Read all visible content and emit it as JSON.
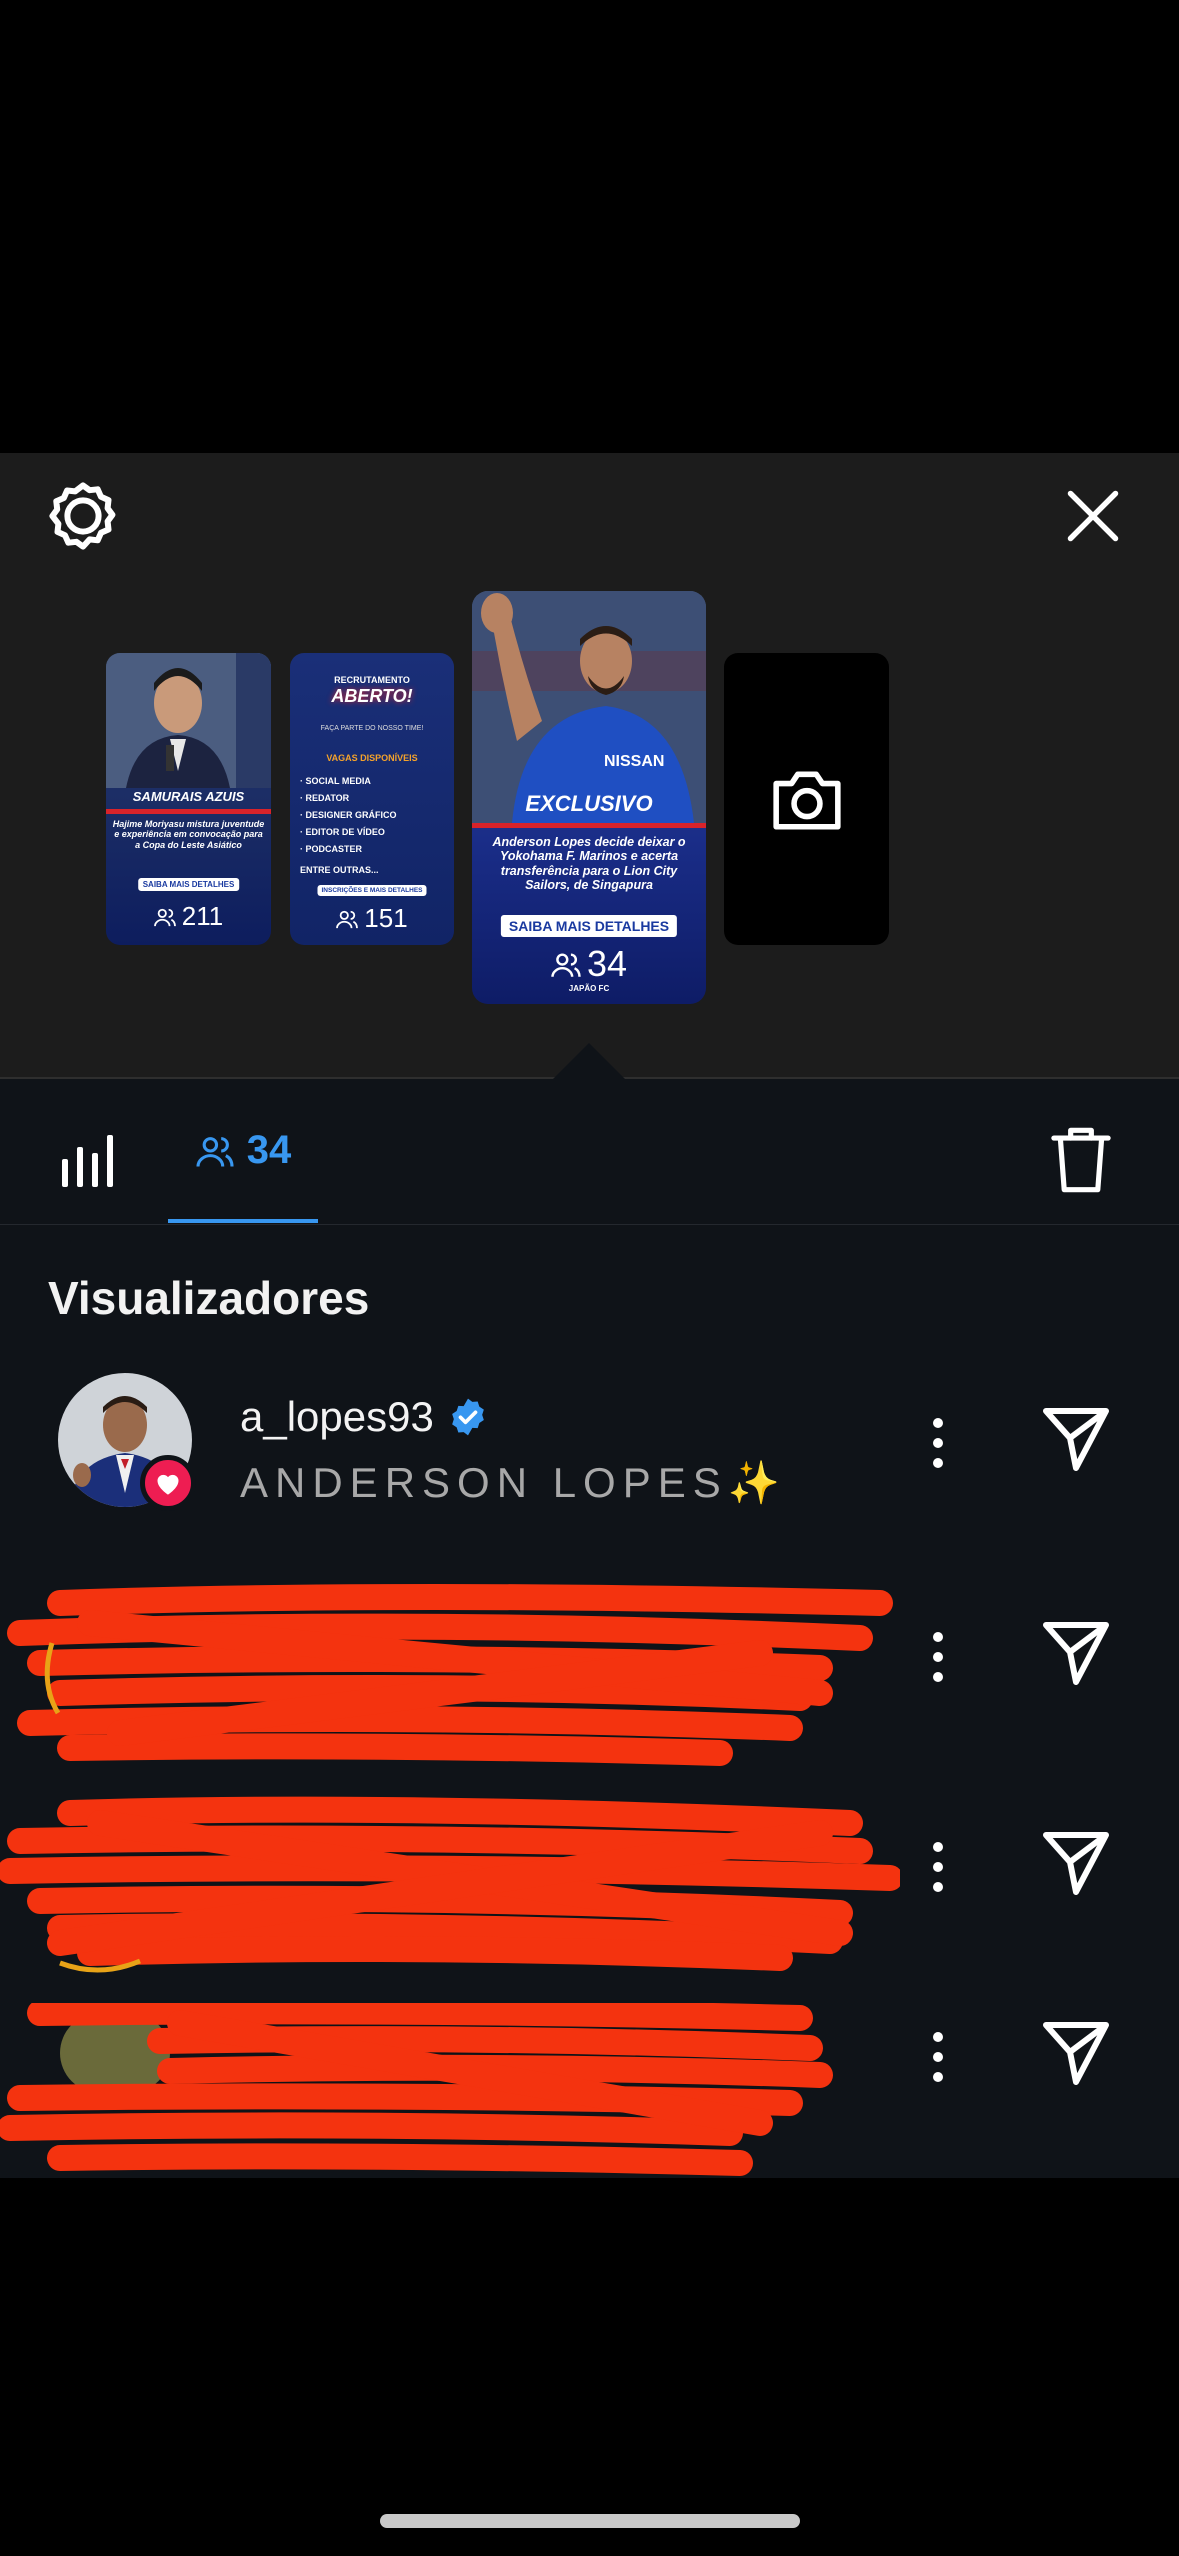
{
  "stories": [
    {
      "caption": "SAMURAIS AZUIS",
      "desc": "Hajime Moriyasu mistura juventude e experiência em convocação para a Copa do Leste Asiático",
      "button": "SAIBA MAIS DETALHES",
      "count": "211"
    },
    {
      "title_top": "RECRUTAMENTO",
      "title_main": "ABERTO!",
      "subtitle": "FAÇA PARTE DO NOSSO TIME!",
      "section": "VAGAS DISPONÍVEIS",
      "items": [
        "· SOCIAL MEDIA",
        "· REDATOR",
        "· DESIGNER GRÁFICO",
        "· EDITOR DE VÍDEO",
        "· PODCASTER"
      ],
      "more": "ENTRE OUTRAS...",
      "button": "INSCRIÇÕES E MAIS DETALHES",
      "count": "151"
    },
    {
      "caption": "EXCLUSIVO",
      "desc": "Anderson Lopes decide deixar o Yokohama F. Marinos e acerta transferência para o Lion City Sailors, de Singapura",
      "button": "SAIBA MAIS DETALHES",
      "count": "34",
      "brand": "JAPÃO FC"
    }
  ],
  "tabs": {
    "viewers_count": "34"
  },
  "section_title": "Visualizadores",
  "viewers": [
    {
      "username": "a_lopes93",
      "verified": true,
      "full_name": "ANDERSON LOPES✨",
      "liked": true
    }
  ],
  "colors": {
    "accent": "#3897f0",
    "like": "#ee1d52",
    "redaction": "#f4330f"
  },
  "icons": {
    "settings": "gear-icon",
    "close": "close-icon",
    "camera": "camera-icon",
    "insights": "bar-chart-icon",
    "viewers": "people-icon",
    "delete": "trash-icon",
    "more": "more-vertical-icon",
    "send": "send-icon",
    "verified": "verified-badge-icon",
    "heart": "heart-icon"
  }
}
